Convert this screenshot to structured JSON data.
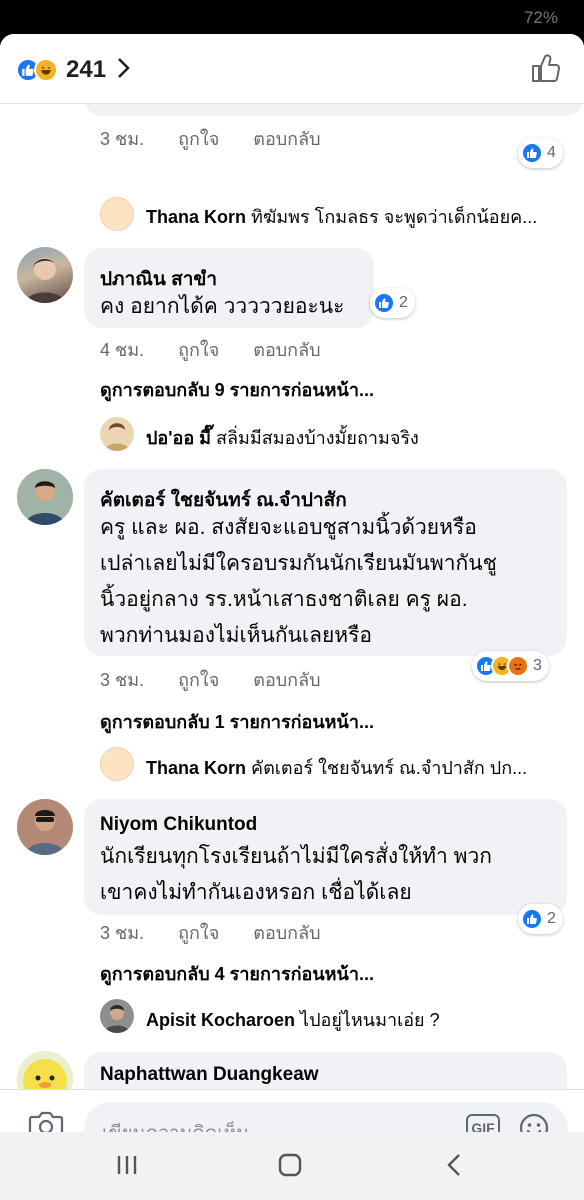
{
  "status": {
    "battery": "72%"
  },
  "header": {
    "reaction_count": "241"
  },
  "feed": {
    "top_meta": {
      "time": "3 ชม.",
      "like": "ถูกใจ",
      "reply": "ตอบกลับ",
      "reactions": "4"
    },
    "reply1": {
      "author": "Thana Korn",
      "text": "ทิฆัมพร โกมลธร จะพูดว่าเด็กน้อยค..."
    },
    "c1": {
      "author": "ปภาณิน สาขำ",
      "text": "คง อยากได้ค วววววยอะนะ",
      "reactions": "2",
      "time": "4 ชม.",
      "like": "ถูกใจ",
      "reply": "ตอบกลับ",
      "more": "ดูการตอบกลับ 9 รายการก่อนหน้า..."
    },
    "reply2": {
      "author": "ปอ'ออ มี๊",
      "text": "สลิ่มมีสมองบ้างมั้ยถามจริง"
    },
    "c2": {
      "author": "คัตเตอร์ ใชยจันทร์ ณ.จำปาสัก",
      "lines": [
        "ครู และ ผอ. สงสัยจะแอบชูสามนิ้วด้วยหรือ",
        "เปล่าเลยไม่มีใครอบรมกันนักเรียนมันพากันชู",
        "นิ้วอยู่กลาง รร.หน้าเสาธงชาติเลย ครู ผอ.",
        "พวกท่านมองไม่เห็นกันเลยหรือ"
      ],
      "reactions": "3",
      "time": "3 ชม.",
      "like": "ถูกใจ",
      "reply": "ตอบกลับ",
      "more": "ดูการตอบกลับ 1 รายการก่อนหน้า..."
    },
    "reply3": {
      "author": "Thana Korn",
      "text": "คัตเตอร์ ใชยจันทร์ ณ.จำปาสัก  ปก..."
    },
    "c3": {
      "author": "Niyom Chikuntod",
      "lines": [
        "นักเรียนทุกโรงเรียนถ้าไม่มีใครสั่งให้ทำ พวก",
        "เขาคงไม่ทำกันเองหรอก เชื่อได้เลย"
      ],
      "reactions": "2",
      "time": "3 ชม.",
      "like": "ถูกใจ",
      "reply": "ตอบกลับ",
      "more": "ดูการตอบกลับ 4 รายการก่อนหน้า..."
    },
    "reply4": {
      "author": "Apisit Kocharoen",
      "text": "ไปอยู่ไหนมาเอ่ย ?"
    },
    "c4": {
      "author": "Naphattwan Duangkeaw"
    }
  },
  "composer": {
    "placeholder": "เขียนความคิดเห็น...",
    "gif_label": "GIF"
  },
  "colors": {
    "accent": "#1877f2",
    "bubble": "#f0f2f5",
    "meta": "#65676b"
  }
}
